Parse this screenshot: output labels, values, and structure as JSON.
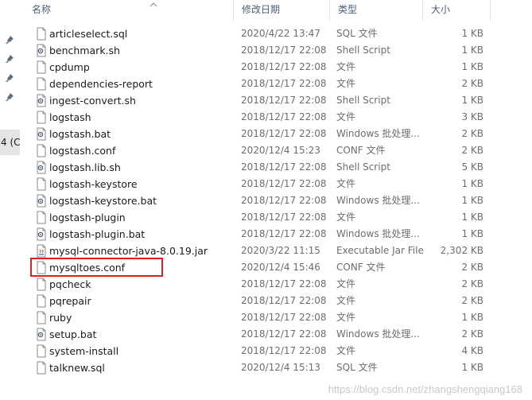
{
  "navigation": {
    "drive_label": "4 (C"
  },
  "columns": {
    "name": "名称",
    "date": "修改日期",
    "type": "类型",
    "size": "大小"
  },
  "files": [
    {
      "name": "articleselect.sql",
      "date": "2020/4/22 13:47",
      "type": "SQL 文件",
      "size": "1 KB",
      "icon": "file-icon"
    },
    {
      "name": "benchmark.sh",
      "date": "2018/12/17 22:08",
      "type": "Shell Script",
      "size": "1 KB",
      "icon": "script-icon"
    },
    {
      "name": "cpdump",
      "date": "2018/12/17 22:08",
      "type": "文件",
      "size": "1 KB",
      "icon": "file-icon"
    },
    {
      "name": "dependencies-report",
      "date": "2018/12/17 22:08",
      "type": "文件",
      "size": "2 KB",
      "icon": "file-icon"
    },
    {
      "name": "ingest-convert.sh",
      "date": "2018/12/17 22:08",
      "type": "Shell Script",
      "size": "1 KB",
      "icon": "script-icon"
    },
    {
      "name": "logstash",
      "date": "2018/12/17 22:08",
      "type": "文件",
      "size": "3 KB",
      "icon": "file-icon"
    },
    {
      "name": "logstash.bat",
      "date": "2018/12/17 22:08",
      "type": "Windows 批处理...",
      "size": "2 KB",
      "icon": "script-icon"
    },
    {
      "name": "logstash.conf",
      "date": "2020/12/4 15:23",
      "type": "CONF 文件",
      "size": "2 KB",
      "icon": "file-icon"
    },
    {
      "name": "logstash.lib.sh",
      "date": "2018/12/17 22:08",
      "type": "Shell Script",
      "size": "5 KB",
      "icon": "script-icon"
    },
    {
      "name": "logstash-keystore",
      "date": "2018/12/17 22:08",
      "type": "文件",
      "size": "1 KB",
      "icon": "file-icon"
    },
    {
      "name": "logstash-keystore.bat",
      "date": "2018/12/17 22:08",
      "type": "Windows 批处理...",
      "size": "1 KB",
      "icon": "script-icon"
    },
    {
      "name": "logstash-plugin",
      "date": "2018/12/17 22:08",
      "type": "文件",
      "size": "1 KB",
      "icon": "file-icon"
    },
    {
      "name": "logstash-plugin.bat",
      "date": "2018/12/17 22:08",
      "type": "Windows 批处理...",
      "size": "1 KB",
      "icon": "script-icon"
    },
    {
      "name": "mysql-connector-java-8.0.19.jar",
      "date": "2020/3/22 11:15",
      "type": "Executable Jar File",
      "size": "2,302 KB",
      "icon": "jar-icon"
    },
    {
      "name": "mysqltoes.conf",
      "date": "2020/12/4 15:46",
      "type": "CONF 文件",
      "size": "2 KB",
      "icon": "file-icon"
    },
    {
      "name": "pqcheck",
      "date": "2018/12/17 22:08",
      "type": "文件",
      "size": "2 KB",
      "icon": "file-icon"
    },
    {
      "name": "pqrepair",
      "date": "2018/12/17 22:08",
      "type": "文件",
      "size": "2 KB",
      "icon": "file-icon"
    },
    {
      "name": "ruby",
      "date": "2018/12/17 22:08",
      "type": "文件",
      "size": "1 KB",
      "icon": "file-icon"
    },
    {
      "name": "setup.bat",
      "date": "2018/12/17 22:08",
      "type": "Windows 批处理...",
      "size": "2 KB",
      "icon": "script-icon"
    },
    {
      "name": "system-install",
      "date": "2018/12/17 22:08",
      "type": "文件",
      "size": "4 KB",
      "icon": "file-icon"
    },
    {
      "name": "talknew.sql",
      "date": "2020/12/4 15:13",
      "type": "SQL 文件",
      "size": "1 KB",
      "icon": "file-icon"
    }
  ],
  "watermark": "https://blog.csdn.net/zhangshengqiang168",
  "colors": {
    "header_text": "#4c607a",
    "secondary_text": "#6d6d6d",
    "highlight_border": "#e02020"
  }
}
